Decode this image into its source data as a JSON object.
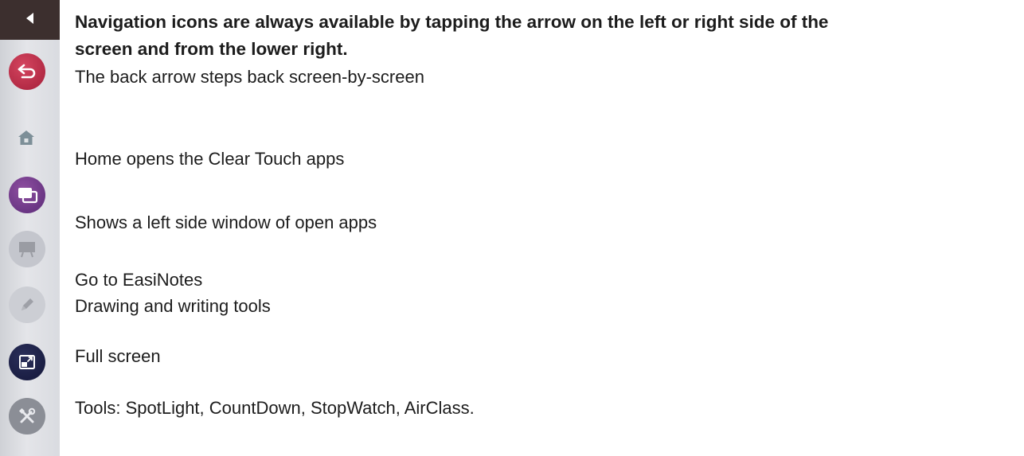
{
  "heading": {
    "line1": "Navigation icons are always available by tapping the arrow on the left or right side of the",
    "line2": "screen and from the lower right."
  },
  "descriptions": [
    "The back arrow steps back screen-by-screen",
    "Home opens the Clear Touch apps",
    "Shows a left side window of open apps",
    "Go to EasiNotes",
    "Drawing and writing tools",
    "Full screen",
    "Tools: SpotLight, CountDown, StopWatch, AirClass."
  ],
  "toolbar": {
    "icons": [
      "collapse-arrow-icon",
      "back-arrow-icon",
      "home-icon",
      "open-apps-icon",
      "easinotes-icon",
      "pen-icon",
      "full-screen-icon",
      "tools-icon"
    ],
    "colors": {
      "collapse_bar": "#3c2f2e",
      "back": "#b8294a",
      "apps": "#6e3a8a",
      "full_screen": "#1d2148",
      "tools": "#8b8e96"
    }
  }
}
